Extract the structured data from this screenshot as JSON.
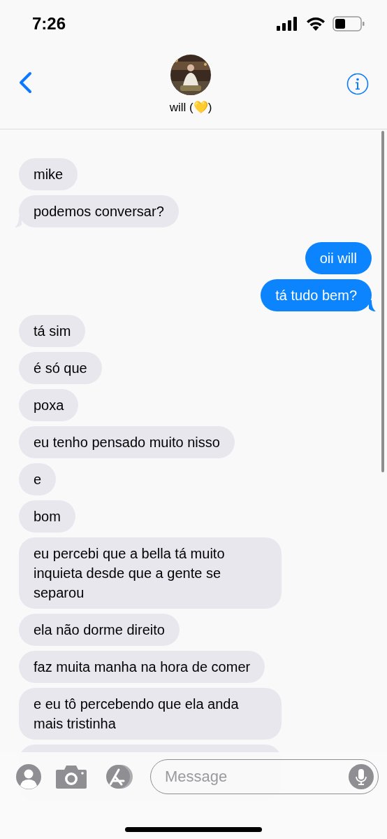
{
  "status_bar": {
    "time": "7:26"
  },
  "contact": {
    "name": "will (💛)"
  },
  "messages": [
    {
      "kind": "received",
      "text": "mike",
      "tail": false
    },
    {
      "kind": "received",
      "text": "podemos conversar?",
      "tail": true
    },
    {
      "kind": "sent",
      "text": "oii will",
      "tail": false
    },
    {
      "kind": "sent",
      "text": "tá tudo bem?",
      "tail": true
    },
    {
      "kind": "received",
      "text": "tá sim",
      "tail": false
    },
    {
      "kind": "received",
      "text": "é só que",
      "tail": false
    },
    {
      "kind": "received",
      "text": "poxa",
      "tail": false
    },
    {
      "kind": "received",
      "text": "eu tenho pensado muito nisso",
      "tail": false
    },
    {
      "kind": "received",
      "text": "e",
      "tail": false
    },
    {
      "kind": "received",
      "text": "bom",
      "tail": false
    },
    {
      "kind": "received",
      "text": "eu percebi que a bella tá muito inquieta desde que a gente se separou",
      "tail": false
    },
    {
      "kind": "received",
      "text": "ela não dorme direito",
      "tail": false
    },
    {
      "kind": "received",
      "text": "faz muita manha na hora de comer",
      "tail": false
    },
    {
      "kind": "received",
      "text": "e eu tô percebendo que ela anda mais tristinha",
      "tail": false
    }
  ],
  "composer": {
    "placeholder": "Message"
  }
}
